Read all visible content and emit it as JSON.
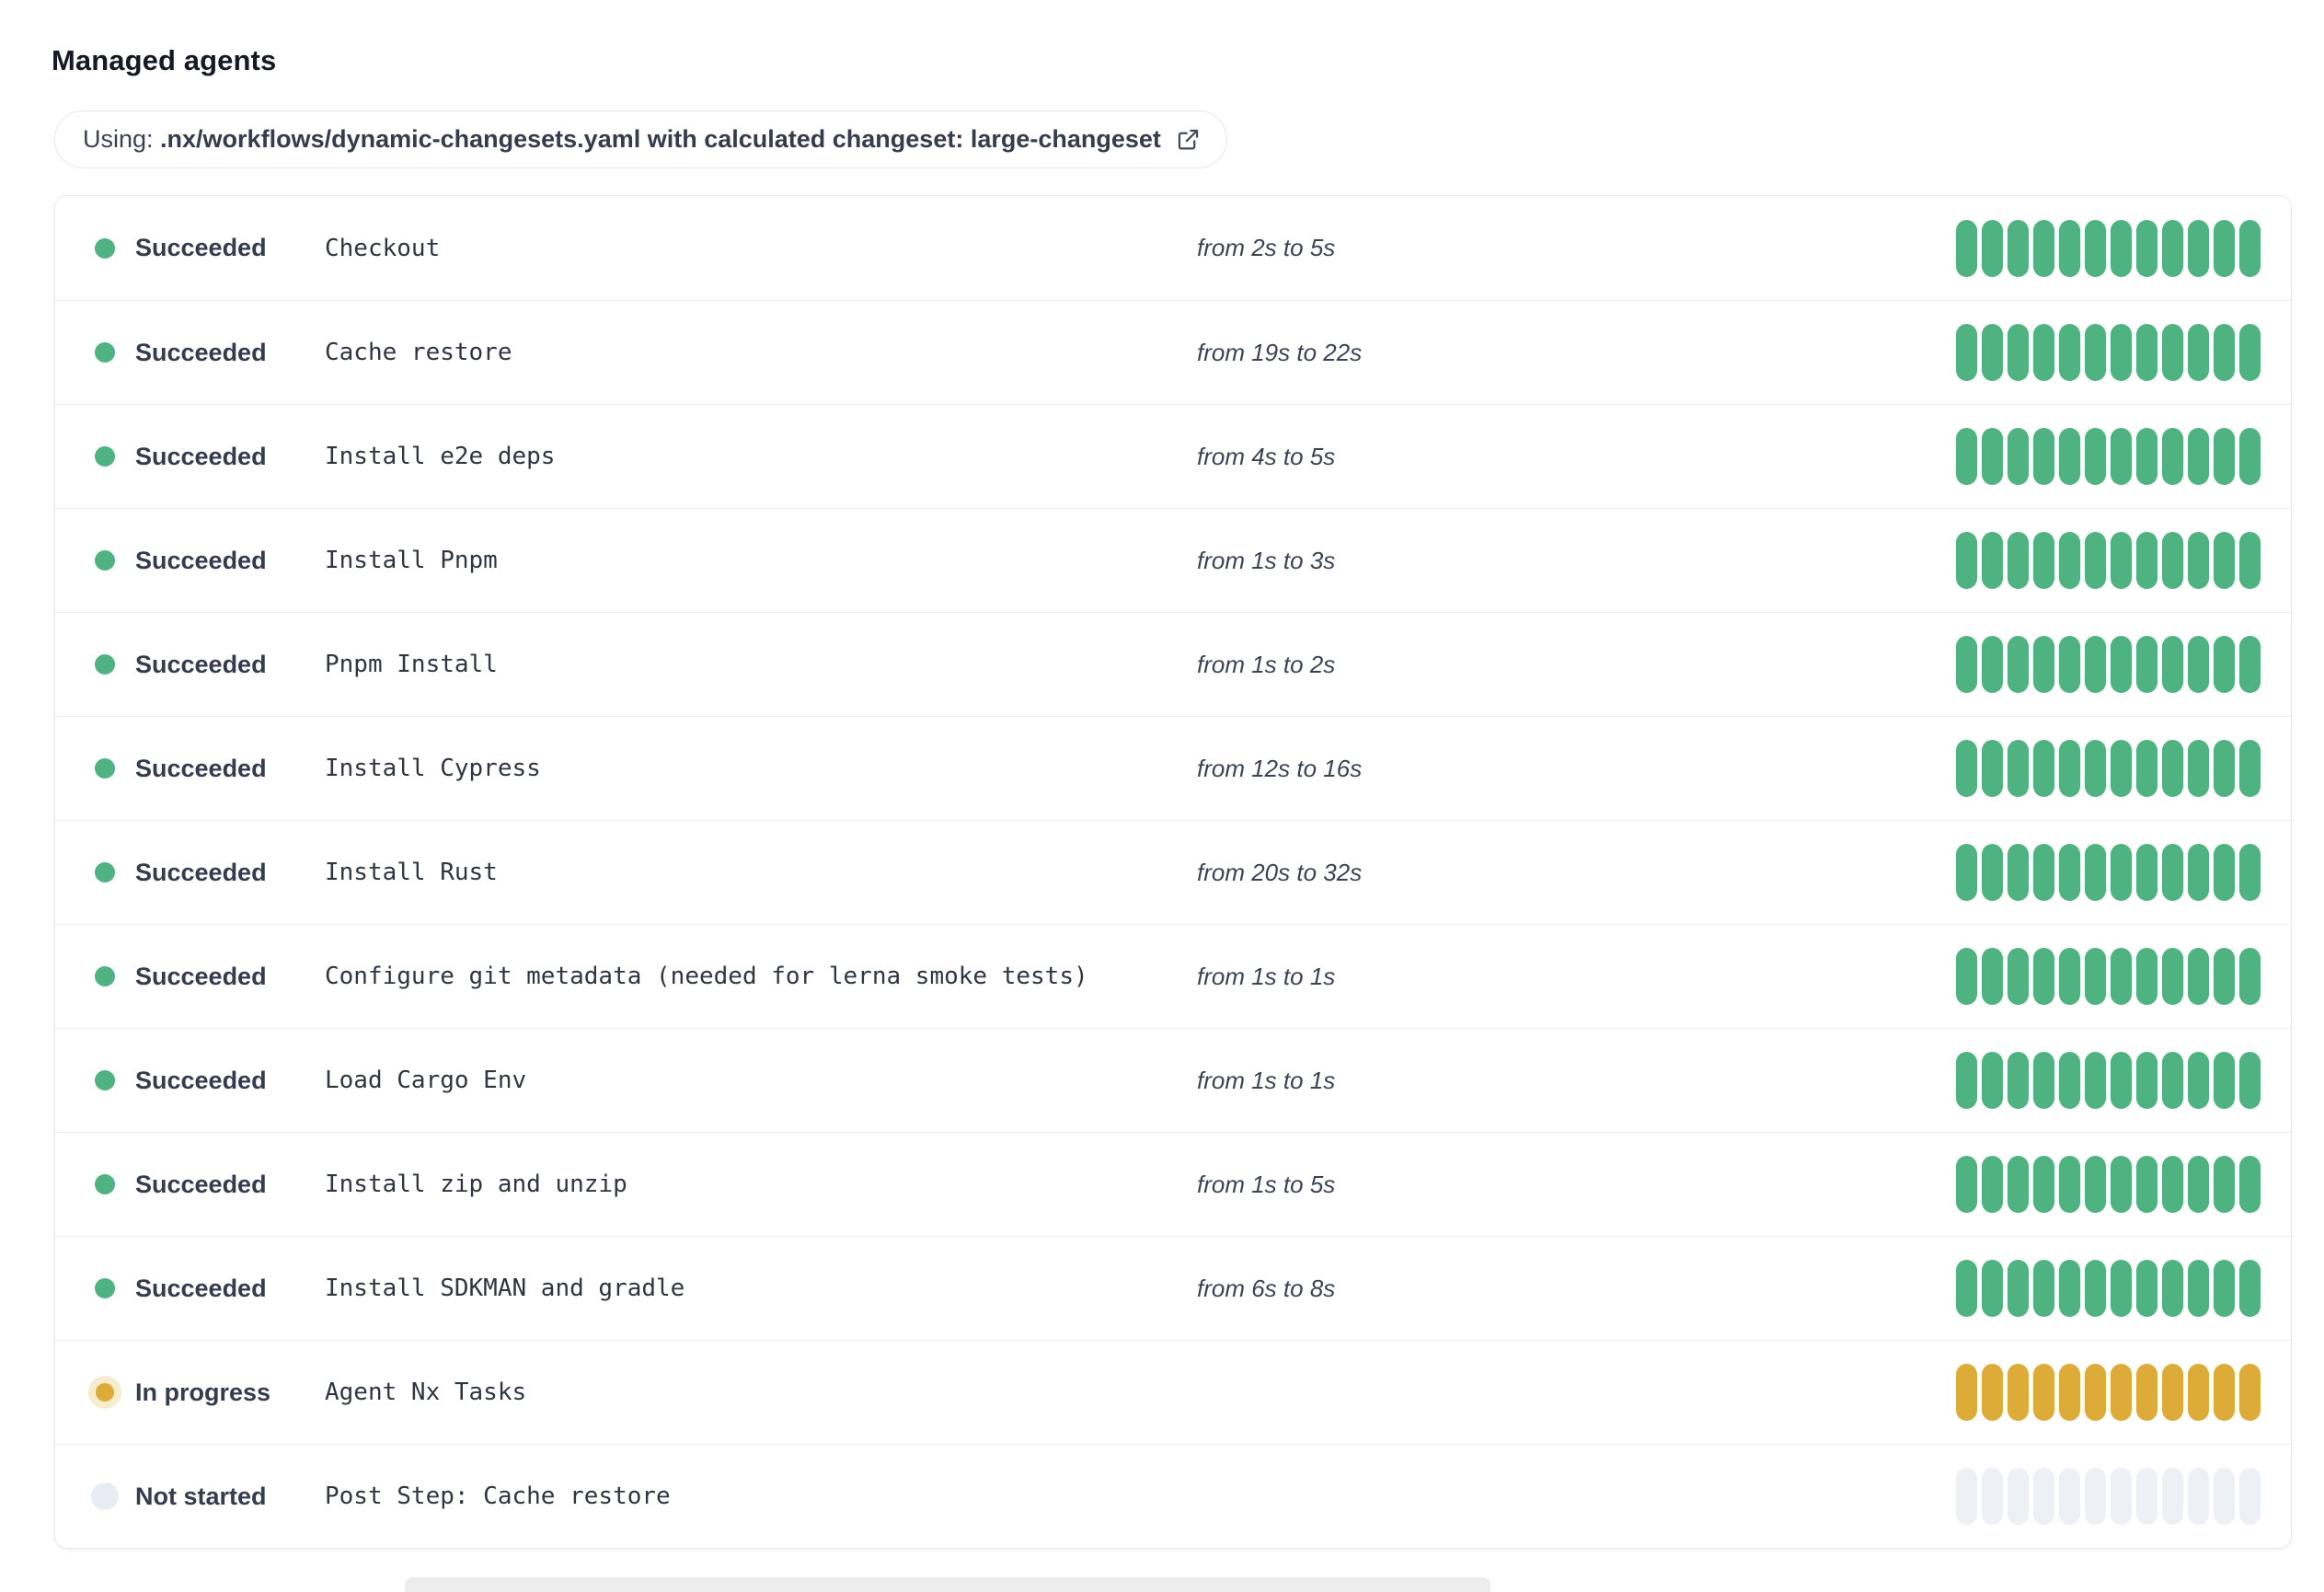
{
  "page": {
    "title": "Managed agents"
  },
  "workflow_banner": {
    "prefix": "Using: ",
    "detail": ".nx/workflows/dynamic-changesets.yaml with calculated changeset: large-changeset",
    "icon": "external-link-icon"
  },
  "colors": {
    "succeeded": "#4eb281",
    "in_progress": "#ddac38",
    "in_progress_halo": "#f6ecce",
    "not_started_dot": "#e9edf3",
    "not_started_bar": "#edf1f6"
  },
  "agents": {
    "bar_segment_count": 12,
    "rows": [
      {
        "status": "Succeeded",
        "state": "succeeded",
        "name": "Checkout",
        "duration": "from 2s to 5s"
      },
      {
        "status": "Succeeded",
        "state": "succeeded",
        "name": "Cache restore",
        "duration": "from 19s to 22s"
      },
      {
        "status": "Succeeded",
        "state": "succeeded",
        "name": "Install e2e deps",
        "duration": "from 4s to 5s"
      },
      {
        "status": "Succeeded",
        "state": "succeeded",
        "name": "Install Pnpm",
        "duration": "from 1s to 3s"
      },
      {
        "status": "Succeeded",
        "state": "succeeded",
        "name": "Pnpm Install",
        "duration": "from 1s to 2s"
      },
      {
        "status": "Succeeded",
        "state": "succeeded",
        "name": "Install Cypress",
        "duration": "from 12s to 16s"
      },
      {
        "status": "Succeeded",
        "state": "succeeded",
        "name": "Install Rust",
        "duration": "from 20s to 32s"
      },
      {
        "status": "Succeeded",
        "state": "succeeded",
        "name": "Configure git metadata (needed for lerna smoke tests)",
        "duration": "from 1s to 1s"
      },
      {
        "status": "Succeeded",
        "state": "succeeded",
        "name": "Load Cargo Env",
        "duration": "from 1s to 1s"
      },
      {
        "status": "Succeeded",
        "state": "succeeded",
        "name": "Install zip and unzip",
        "duration": "from 1s to 5s"
      },
      {
        "status": "Succeeded",
        "state": "succeeded",
        "name": "Install SDKMAN and gradle",
        "duration": "from 6s to 8s"
      },
      {
        "status": "In progress",
        "state": "in-progress",
        "name": "Agent Nx Tasks",
        "duration": ""
      },
      {
        "status": "Not started",
        "state": "not-started",
        "name": "Post Step: Cache restore",
        "duration": ""
      }
    ]
  }
}
